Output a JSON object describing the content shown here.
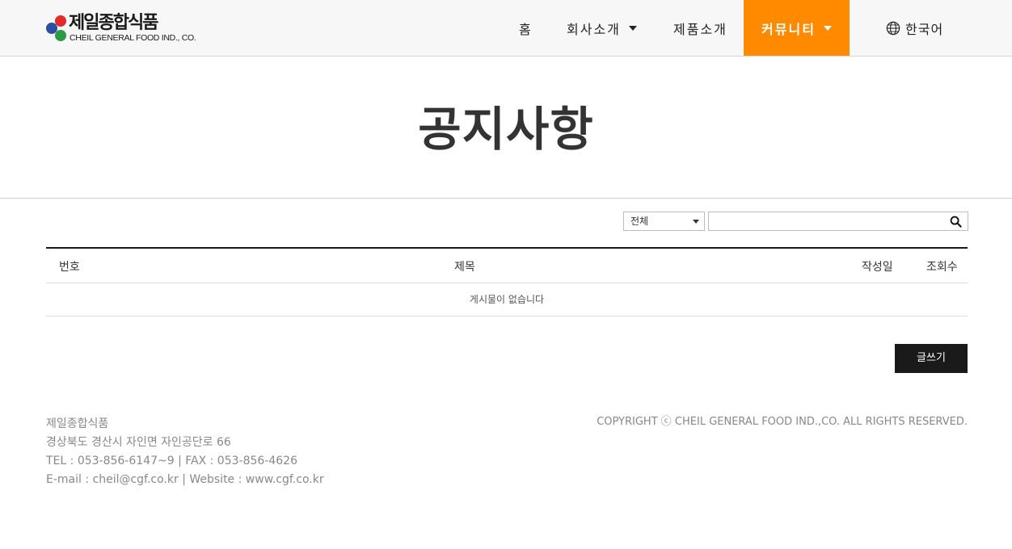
{
  "logo": {
    "name_ko": "제일종합식품",
    "name_en": "CHEIL GENERAL FOOD IND., CO."
  },
  "nav": {
    "home": "홈",
    "about": "회사소개",
    "products": "제품소개",
    "community": "커뮤니티",
    "language": "한국어"
  },
  "page": {
    "title": "공지사항"
  },
  "search": {
    "select_value": "전체",
    "input_value": ""
  },
  "table": {
    "headers": {
      "num": "번호",
      "title": "제목",
      "date": "작성일",
      "views": "조회수"
    },
    "empty_message": "게시물이 없습니다"
  },
  "buttons": {
    "write": "글쓰기"
  },
  "footer": {
    "company": "제일종합식품",
    "address": "경상북도 경산시 자인면 자인공단로 66",
    "tel_fax": "TEL : 053-856-6147~9  |  FAX : 053-856-4626",
    "email_web": "E-mail : cheil@cgf.co.kr  |  Website : www.cgf.co.kr",
    "copyright": "COPYRIGHT ⓒ CHEIL GENERAL FOOD IND.,CO. ALL RIGHTS RESERVED."
  },
  "colors": {
    "accent": "#ff8a00",
    "dark": "#1a1a1a",
    "logo_red": "#e12a2a",
    "logo_blue": "#2a4fa3",
    "logo_green": "#2f9a46"
  }
}
